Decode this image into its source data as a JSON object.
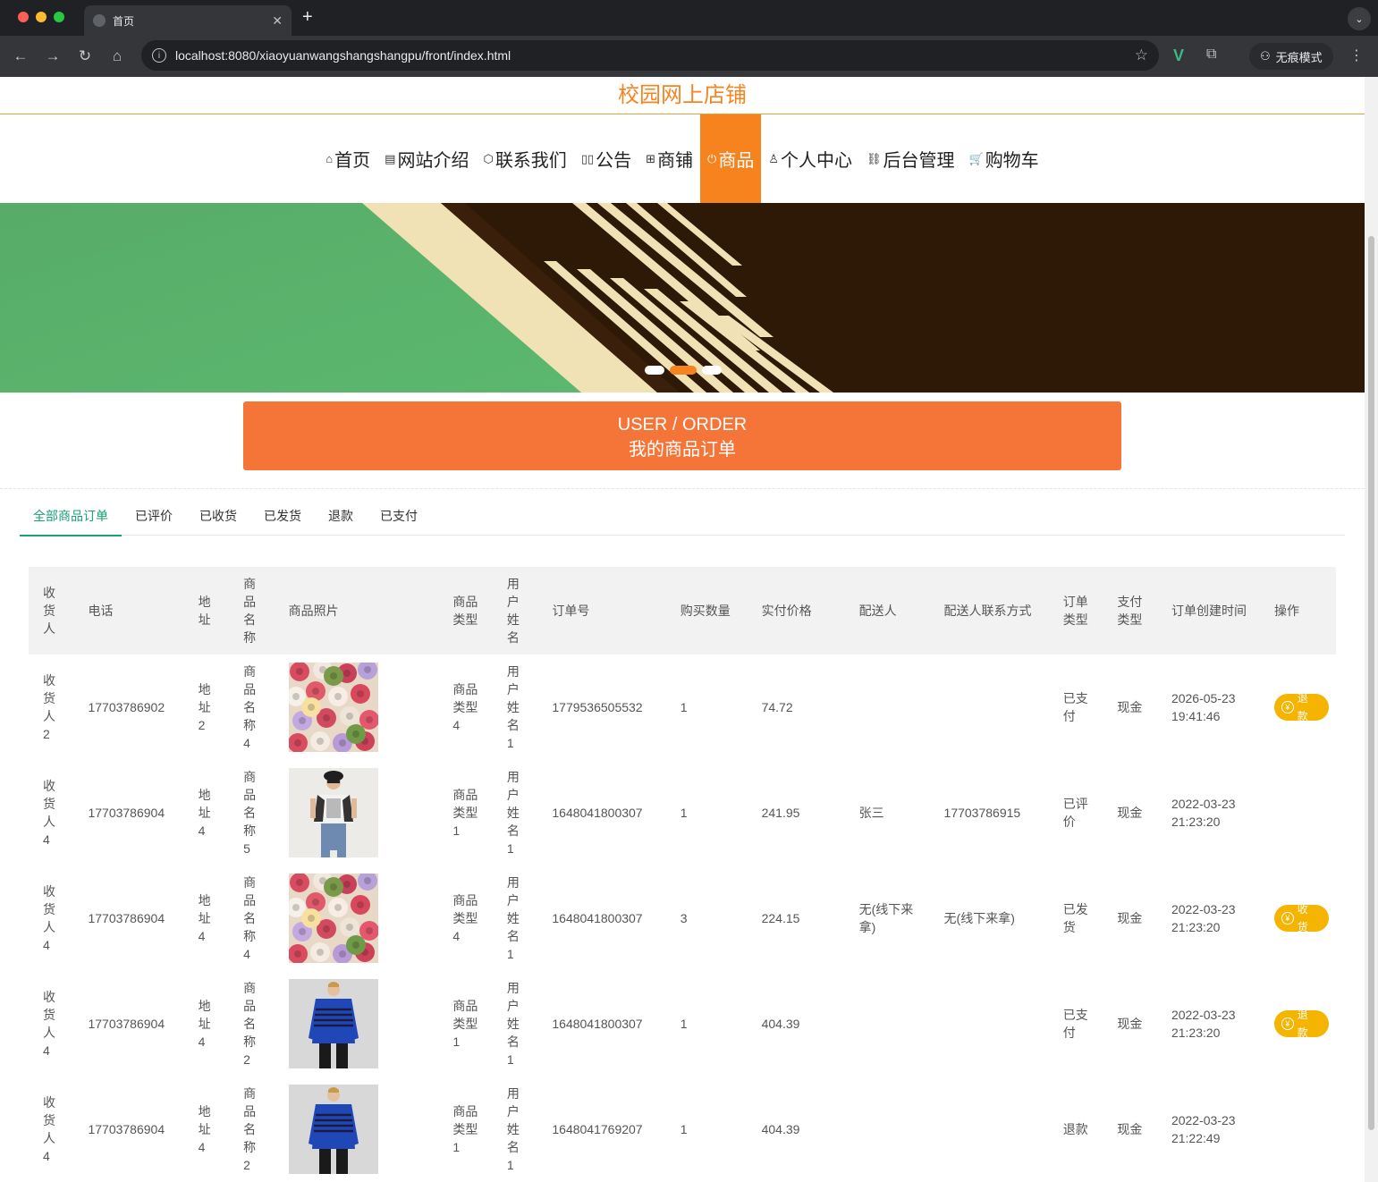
{
  "browser": {
    "tab_title": "首页",
    "url": "localhost:8080/xiaoyuanwangshangshangpu/front/index.html",
    "incognito_label": "无痕模式"
  },
  "site": {
    "title": "校园网上店铺",
    "nav": [
      {
        "label": "首页",
        "icon": "home-icon"
      },
      {
        "label": "网站介绍",
        "icon": "document-icon"
      },
      {
        "label": "联系我们",
        "icon": "cube-icon"
      },
      {
        "label": "公告",
        "icon": "book-icon"
      },
      {
        "label": "商铺",
        "icon": "gift-icon"
      },
      {
        "label": "商品",
        "icon": "power-icon",
        "active": true
      },
      {
        "label": "个人中心",
        "icon": "user-icon"
      },
      {
        "label": "后台管理",
        "icon": "link-icon"
      },
      {
        "label": "购物车",
        "icon": "cart-icon"
      }
    ]
  },
  "order_banner": {
    "title_en": "USER / ORDER",
    "title_cn": "我的商品订单"
  },
  "order_tabs": [
    "全部商品订单",
    "已评价",
    "已收货",
    "已发货",
    "退款",
    "已支付"
  ],
  "table": {
    "headers": [
      "收货人",
      "电话",
      "地址",
      "商品名称",
      "商品照片",
      "商品类型",
      "用户姓名",
      "订单号",
      "购买数量",
      "实付价格",
      "配送人",
      "配送人联系方式",
      "订单类型",
      "支付类型",
      "订单创建时间",
      "操作"
    ],
    "rows": [
      {
        "receiver": "收货人2",
        "phone": "17703786902",
        "address": "地址2",
        "product": "商品名称4",
        "image": "flowers",
        "type": "商品类型4",
        "username": "用户姓名1",
        "order_no": "1779536505532",
        "qty": "1",
        "price": "74.72",
        "courier": "",
        "courier_phone": "",
        "order_status": "已支付",
        "pay_type": "现金",
        "created": "2026-05-23 19:41:46",
        "action": "退款"
      },
      {
        "receiver": "收货人4",
        "phone": "17703786904",
        "address": "地址4",
        "product": "商品名称5",
        "image": "woman",
        "type": "商品类型1",
        "username": "用户姓名1",
        "order_no": "1648041800307",
        "qty": "1",
        "price": "241.95",
        "courier": "张三",
        "courier_phone": "17703786915",
        "order_status": "已评价",
        "pay_type": "现金",
        "created": "2022-03-23 21:23:20",
        "action": ""
      },
      {
        "receiver": "收货人4",
        "phone": "17703786904",
        "address": "地址4",
        "product": "商品名称4",
        "image": "flowers",
        "type": "商品类型4",
        "username": "用户姓名1",
        "order_no": "1648041800307",
        "qty": "3",
        "price": "224.15",
        "courier": "无(线下来拿)",
        "courier_phone": "无(线下来拿)",
        "order_status": "已发货",
        "pay_type": "现金",
        "created": "2022-03-23 21:23:20",
        "action": "收货"
      },
      {
        "receiver": "收货人4",
        "phone": "17703786904",
        "address": "地址4",
        "product": "商品名称2",
        "image": "sweater",
        "type": "商品类型1",
        "username": "用户姓名1",
        "order_no": "1648041800307",
        "qty": "1",
        "price": "404.39",
        "courier": "",
        "courier_phone": "",
        "order_status": "已支付",
        "pay_type": "现金",
        "created": "2022-03-23 21:23:20",
        "action": "退款"
      },
      {
        "receiver": "收货人4",
        "phone": "17703786904",
        "address": "地址4",
        "product": "商品名称2",
        "image": "sweater",
        "type": "商品类型1",
        "username": "用户姓名1",
        "order_no": "1648041769207",
        "qty": "1",
        "price": "404.39",
        "courier": "",
        "courier_phone": "",
        "order_status": "退款",
        "pay_type": "现金",
        "created": "2022-03-23 21:22:49",
        "action": ""
      }
    ]
  },
  "colors": {
    "accent": "#f7831f",
    "order_banner": "#f57538",
    "tab_active": "#1a9e78",
    "action_button": "#f5b400"
  }
}
